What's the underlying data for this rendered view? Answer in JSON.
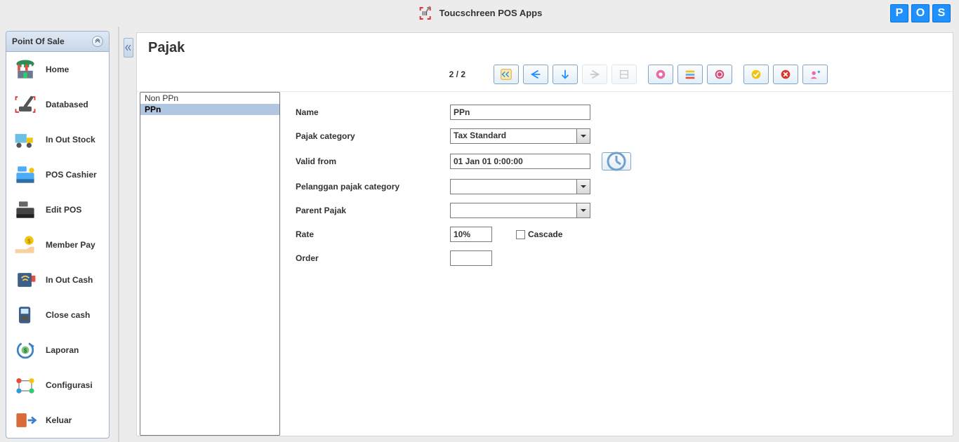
{
  "app": {
    "title": "Toucschreen POS Apps",
    "logo_letters": [
      "P",
      "O",
      "S"
    ]
  },
  "sidebar": {
    "title": "Point Of Sale",
    "items": [
      {
        "label": "Home"
      },
      {
        "label": "Databased"
      },
      {
        "label": "In Out Stock"
      },
      {
        "label": "POS Cashier"
      },
      {
        "label": "Edit POS"
      },
      {
        "label": "Member Pay"
      },
      {
        "label": "In Out Cash"
      },
      {
        "label": "Close cash"
      },
      {
        "label": "Laporan"
      },
      {
        "label": "Configurasi"
      },
      {
        "label": "Keluar"
      }
    ]
  },
  "page": {
    "title": "Pajak",
    "counter": "2 / 2"
  },
  "list": {
    "items": [
      {
        "label": "Non PPn",
        "selected": false
      },
      {
        "label": "PPn",
        "selected": true
      }
    ]
  },
  "form": {
    "name_label": "Name",
    "name_value": "PPn",
    "category_label": "Pajak category",
    "category_value": "Tax Standard",
    "validfrom_label": "Valid from",
    "validfrom_value": "01 Jan 01 0:00:00",
    "custcat_label": "Pelanggan pajak category",
    "custcat_value": "",
    "parent_label": "Parent Pajak",
    "parent_value": "",
    "rate_label": "Rate",
    "rate_value": "10%",
    "cascade_label": "Cascade",
    "order_label": "Order",
    "order_value": ""
  }
}
